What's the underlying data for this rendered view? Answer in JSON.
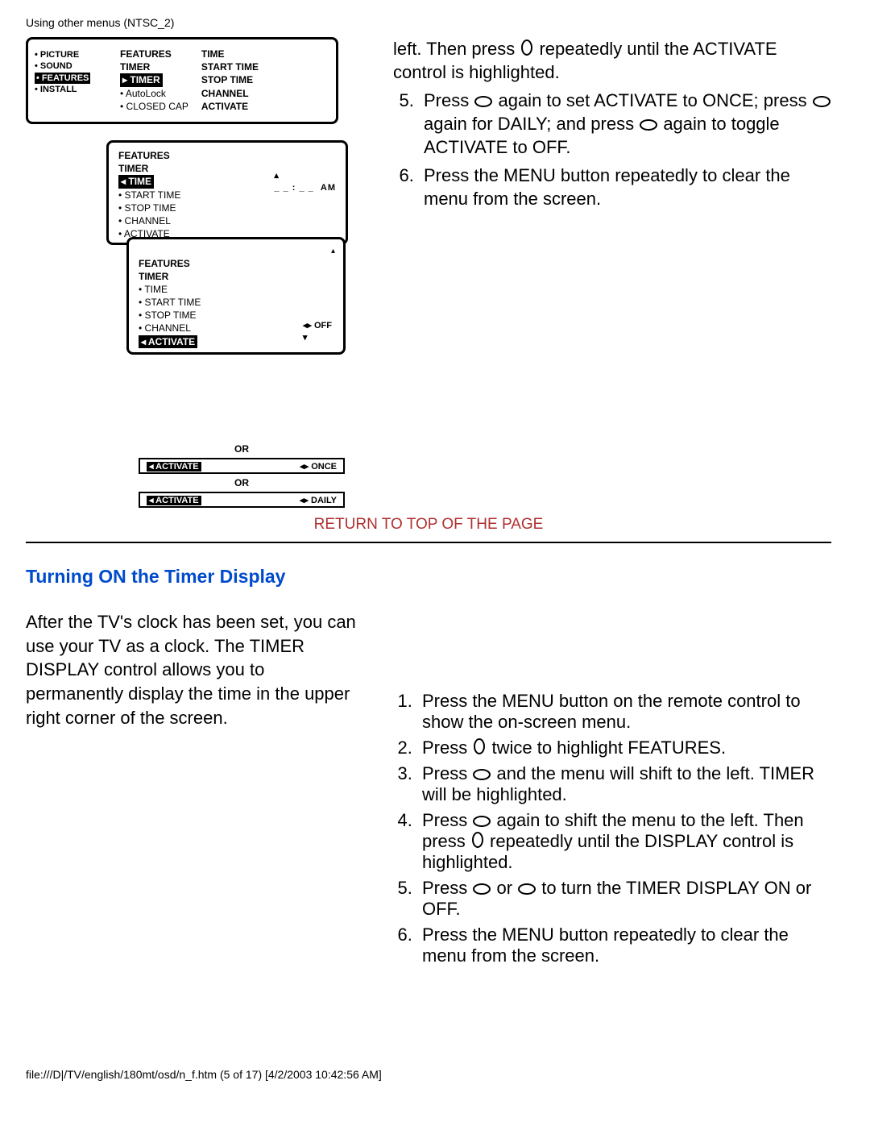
{
  "header": "Using other menus (NTSC_2)",
  "diagram": {
    "box1": {
      "left_items": [
        "• PICTURE",
        "• SOUND",
        "• FEATURES",
        "• INSTALL"
      ],
      "left_highlight": "• FEATURES",
      "mid_title": "FEATURES",
      "mid_sub": "TIMER",
      "mid_highlight": "TIMER",
      "mid_items": [
        "• AutoLock",
        "• CLOSED CAP"
      ],
      "right_items": [
        "TIME",
        "START TIME",
        "STOP TIME",
        "CHANNEL",
        "ACTIVATE"
      ]
    },
    "box2": {
      "title": "FEATURES",
      "sub": "TIMER",
      "highlight": "TIME",
      "items": [
        "• START TIME",
        "• STOP TIME",
        "• CHANNEL",
        "• ACTIVATE"
      ],
      "blank_text": "__ __ : __ __  AM"
    },
    "box3": {
      "title": "FEATURES",
      "sub": "TIMER",
      "items": [
        "• TIME",
        "• START TIME",
        "• STOP TIME",
        "• CHANNEL"
      ],
      "highlight": "ACTIVATE",
      "value": "OFF"
    },
    "or_label": "OR",
    "bar_once": {
      "label": "ACTIVATE",
      "value": "ONCE"
    },
    "bar_daily": {
      "label": "ACTIVATE",
      "value": "DAILY"
    }
  },
  "top_instr": {
    "pre_text": "left. Then press ",
    "pre_text2": " repeatedly until the ACTIVATE control is highlighted.",
    "li5_a": "Press ",
    "li5_b": " again to set ACTIVATE to ONCE; press ",
    "li5_c": " again for DAILY; and press ",
    "li5_d": " again to toggle ACTIVATE to OFF.",
    "li6": "Press the MENU button repeatedly to clear the menu from the screen."
  },
  "return_link": "RETURN TO TOP OF THE PAGE",
  "section_title": "Turning ON the Timer Display",
  "intro_para": "After the TV's clock has been set, you can use your TV as a clock. The TIMER DISPLAY control allows you to permanently display the time in the upper right corner of the screen.",
  "steps": {
    "s1": "Press the MENU button on the remote control to show the on-screen menu.",
    "s2_a": "Press ",
    "s2_b": " twice to highlight FEATURES.",
    "s3_a": "Press ",
    "s3_b": " and the menu will shift to the left. TIMER will be highlighted.",
    "s4_a": "Press ",
    "s4_b": " again to shift the menu to the left. Then press ",
    "s4_c": " repeatedly until the DISPLAY control is highlighted.",
    "s5_a": "Press ",
    "s5_b": " or ",
    "s5_c": " to turn the TIMER DISPLAY ON or OFF.",
    "s6": "Press the MENU button repeatedly to clear the menu from the screen."
  },
  "footer": "file:///D|/TV/english/180mt/osd/n_f.htm (5 of 17) [4/2/2003 10:42:56 AM]"
}
